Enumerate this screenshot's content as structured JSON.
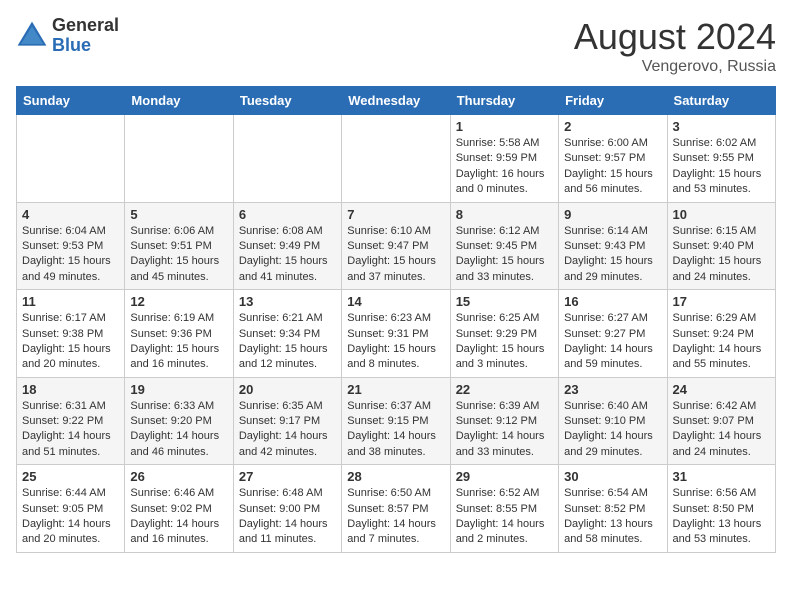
{
  "logo": {
    "general": "General",
    "blue": "Blue"
  },
  "title": "August 2024",
  "location": "Vengerovo, Russia",
  "days_of_week": [
    "Sunday",
    "Monday",
    "Tuesday",
    "Wednesday",
    "Thursday",
    "Friday",
    "Saturday"
  ],
  "weeks": [
    [
      {
        "day": "",
        "info": ""
      },
      {
        "day": "",
        "info": ""
      },
      {
        "day": "",
        "info": ""
      },
      {
        "day": "",
        "info": ""
      },
      {
        "day": "1",
        "info": "Sunrise: 5:58 AM\nSunset: 9:59 PM\nDaylight: 16 hours\nand 0 minutes."
      },
      {
        "day": "2",
        "info": "Sunrise: 6:00 AM\nSunset: 9:57 PM\nDaylight: 15 hours\nand 56 minutes."
      },
      {
        "day": "3",
        "info": "Sunrise: 6:02 AM\nSunset: 9:55 PM\nDaylight: 15 hours\nand 53 minutes."
      }
    ],
    [
      {
        "day": "4",
        "info": "Sunrise: 6:04 AM\nSunset: 9:53 PM\nDaylight: 15 hours\nand 49 minutes."
      },
      {
        "day": "5",
        "info": "Sunrise: 6:06 AM\nSunset: 9:51 PM\nDaylight: 15 hours\nand 45 minutes."
      },
      {
        "day": "6",
        "info": "Sunrise: 6:08 AM\nSunset: 9:49 PM\nDaylight: 15 hours\nand 41 minutes."
      },
      {
        "day": "7",
        "info": "Sunrise: 6:10 AM\nSunset: 9:47 PM\nDaylight: 15 hours\nand 37 minutes."
      },
      {
        "day": "8",
        "info": "Sunrise: 6:12 AM\nSunset: 9:45 PM\nDaylight: 15 hours\nand 33 minutes."
      },
      {
        "day": "9",
        "info": "Sunrise: 6:14 AM\nSunset: 9:43 PM\nDaylight: 15 hours\nand 29 minutes."
      },
      {
        "day": "10",
        "info": "Sunrise: 6:15 AM\nSunset: 9:40 PM\nDaylight: 15 hours\nand 24 minutes."
      }
    ],
    [
      {
        "day": "11",
        "info": "Sunrise: 6:17 AM\nSunset: 9:38 PM\nDaylight: 15 hours\nand 20 minutes."
      },
      {
        "day": "12",
        "info": "Sunrise: 6:19 AM\nSunset: 9:36 PM\nDaylight: 15 hours\nand 16 minutes."
      },
      {
        "day": "13",
        "info": "Sunrise: 6:21 AM\nSunset: 9:34 PM\nDaylight: 15 hours\nand 12 minutes."
      },
      {
        "day": "14",
        "info": "Sunrise: 6:23 AM\nSunset: 9:31 PM\nDaylight: 15 hours\nand 8 minutes."
      },
      {
        "day": "15",
        "info": "Sunrise: 6:25 AM\nSunset: 9:29 PM\nDaylight: 15 hours\nand 3 minutes."
      },
      {
        "day": "16",
        "info": "Sunrise: 6:27 AM\nSunset: 9:27 PM\nDaylight: 14 hours\nand 59 minutes."
      },
      {
        "day": "17",
        "info": "Sunrise: 6:29 AM\nSunset: 9:24 PM\nDaylight: 14 hours\nand 55 minutes."
      }
    ],
    [
      {
        "day": "18",
        "info": "Sunrise: 6:31 AM\nSunset: 9:22 PM\nDaylight: 14 hours\nand 51 minutes."
      },
      {
        "day": "19",
        "info": "Sunrise: 6:33 AM\nSunset: 9:20 PM\nDaylight: 14 hours\nand 46 minutes."
      },
      {
        "day": "20",
        "info": "Sunrise: 6:35 AM\nSunset: 9:17 PM\nDaylight: 14 hours\nand 42 minutes."
      },
      {
        "day": "21",
        "info": "Sunrise: 6:37 AM\nSunset: 9:15 PM\nDaylight: 14 hours\nand 38 minutes."
      },
      {
        "day": "22",
        "info": "Sunrise: 6:39 AM\nSunset: 9:12 PM\nDaylight: 14 hours\nand 33 minutes."
      },
      {
        "day": "23",
        "info": "Sunrise: 6:40 AM\nSunset: 9:10 PM\nDaylight: 14 hours\nand 29 minutes."
      },
      {
        "day": "24",
        "info": "Sunrise: 6:42 AM\nSunset: 9:07 PM\nDaylight: 14 hours\nand 24 minutes."
      }
    ],
    [
      {
        "day": "25",
        "info": "Sunrise: 6:44 AM\nSunset: 9:05 PM\nDaylight: 14 hours\nand 20 minutes."
      },
      {
        "day": "26",
        "info": "Sunrise: 6:46 AM\nSunset: 9:02 PM\nDaylight: 14 hours\nand 16 minutes."
      },
      {
        "day": "27",
        "info": "Sunrise: 6:48 AM\nSunset: 9:00 PM\nDaylight: 14 hours\nand 11 minutes."
      },
      {
        "day": "28",
        "info": "Sunrise: 6:50 AM\nSunset: 8:57 PM\nDaylight: 14 hours\nand 7 minutes."
      },
      {
        "day": "29",
        "info": "Sunrise: 6:52 AM\nSunset: 8:55 PM\nDaylight: 14 hours\nand 2 minutes."
      },
      {
        "day": "30",
        "info": "Sunrise: 6:54 AM\nSunset: 8:52 PM\nDaylight: 13 hours\nand 58 minutes."
      },
      {
        "day": "31",
        "info": "Sunrise: 6:56 AM\nSunset: 8:50 PM\nDaylight: 13 hours\nand 53 minutes."
      }
    ]
  ]
}
